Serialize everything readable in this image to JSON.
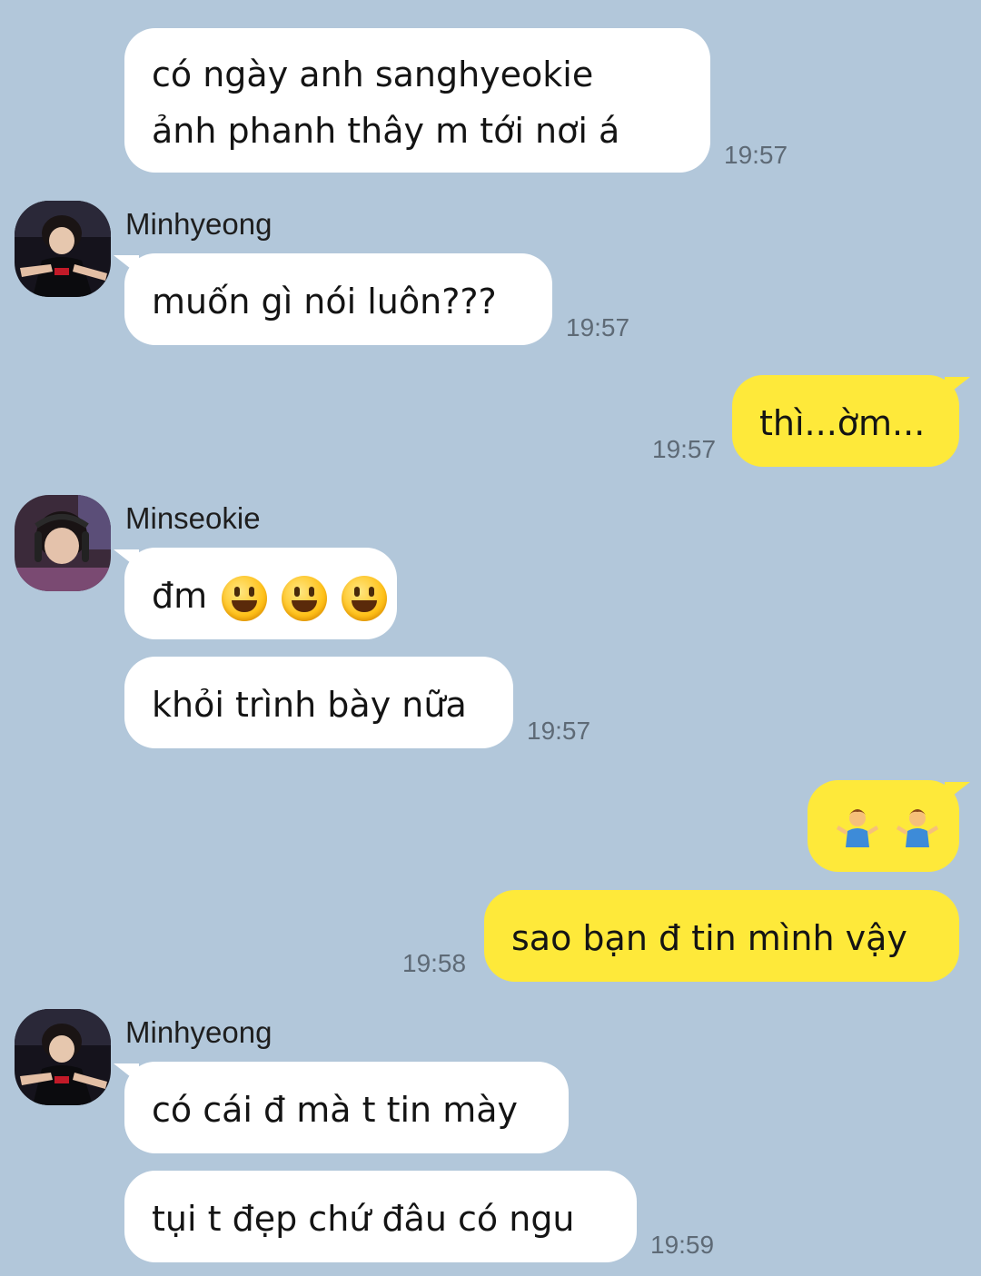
{
  "colors": {
    "background": "#b2c7da",
    "bubble_other": "#ffffff",
    "bubble_mine": "#fee93a"
  },
  "messages": [
    {
      "lines": [
        "có ngày anh sanghyeokie",
        "ảnh phanh thây m tới nơi á"
      ],
      "time": "19:57"
    },
    {
      "sender": "Minhyeong",
      "avatar": "minhyeong-avatar",
      "text": "muốn gì nói luôn???",
      "time": "19:57"
    },
    {
      "text": "thì...ờm...",
      "time": "19:57"
    },
    {
      "sender": "Minseokie",
      "avatar": "minseokie-avatar",
      "text": "đm",
      "emoji": [
        "grinning-face-icon",
        "grinning-face-icon",
        "grinning-face-icon"
      ]
    },
    {
      "text": "khỏi trình bày nữa",
      "time": "19:57"
    },
    {
      "emoji": [
        "person-shrugging-icon",
        "person-shrugging-icon"
      ]
    },
    {
      "text": "sao bạn đ tin mình vậy",
      "time": "19:58"
    },
    {
      "sender": "Minhyeong",
      "avatar": "minhyeong-avatar",
      "text": "có cái đ mà t tin mày"
    },
    {
      "text": "tụi t đẹp chứ đâu có ngu",
      "time": "19:59"
    }
  ]
}
